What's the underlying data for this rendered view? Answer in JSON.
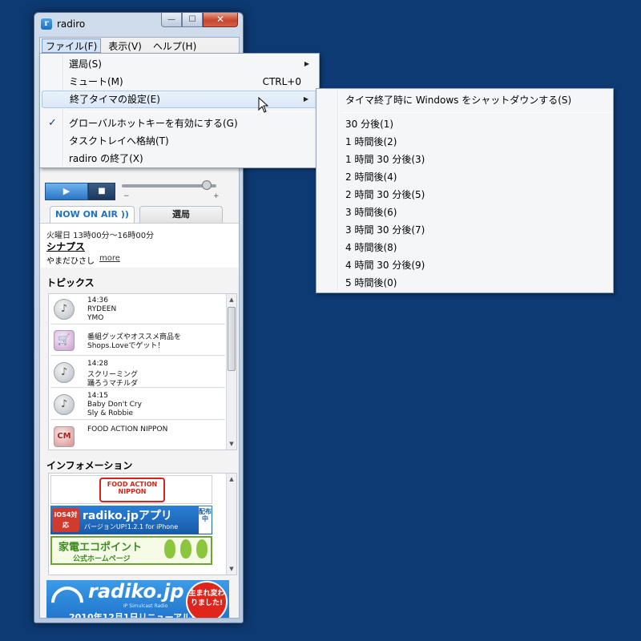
{
  "window": {
    "title": "radiro",
    "min_glyph": "—",
    "max_glyph": "☐",
    "close_glyph": "✕"
  },
  "menubar": {
    "items": [
      "ファイル(F)",
      "表示(V)",
      "ヘルプ(H)"
    ]
  },
  "player": {
    "play_glyph": "▶",
    "stop_glyph": "■",
    "vol_min": "−",
    "vol_max": "+"
  },
  "tabs": {
    "onair": "NOW ON AIR",
    "onair_icon": "))",
    "senkyoku": "選局"
  },
  "program": {
    "time": "火曜日 13時00分～16時00分",
    "title": "シナプス",
    "person": "やまだひさし",
    "more": "more"
  },
  "topics": {
    "heading": "トピックス",
    "items": [
      {
        "icon": "music-note-icon",
        "l1": "14:36",
        "l2": "RYDEEN",
        "l3": "YMO"
      },
      {
        "icon": "cart-icon",
        "l1": "番組グッズやオススメ商品を",
        "l2": "Shops.Loveでゲット！",
        "l3": ""
      },
      {
        "icon": "music-note-icon",
        "l1": "14:28",
        "l2": "スクリーミング",
        "l3": "踊ろうマチルダ"
      },
      {
        "icon": "music-note-icon",
        "l1": "14:15",
        "l2": "Baby Don't Cry",
        "l3": "Sly & Robbie"
      },
      {
        "icon": "cm-logo-icon",
        "l1": "FOOD  ACTION NIPPON",
        "l2": "",
        "l3": ""
      }
    ]
  },
  "info": {
    "heading": "インフォメーション",
    "food_banner": "FOOD ACTION NIPPON",
    "app_banner": {
      "ios": "iOS4対応",
      "name": "radiko.jpアプリ",
      "sub": "バージョンUP!1.2.1 for iPhone",
      "right": "配布中"
    },
    "eco_banner": {
      "title": "家電エコポイント",
      "sub": "公式ホームページ"
    }
  },
  "radiko_banner": {
    "name": "radiko.jp",
    "small": "IP Simulcast Radio",
    "date": "2010年12月1日リニューアル!",
    "circle": "生まれ変わりました!"
  },
  "file_menu": {
    "items": [
      {
        "label": "選局(S)",
        "shortcut": "",
        "submenu": true,
        "checked": false
      },
      {
        "label": "ミュート(M)",
        "shortcut": "CTRL+0",
        "submenu": false,
        "checked": false
      },
      {
        "label": "終了タイマの設定(E)",
        "shortcut": "",
        "submenu": true,
        "checked": false,
        "highlighted": true
      },
      {
        "label": "グローバルホットキーを有効にする(G)",
        "shortcut": "",
        "submenu": false,
        "checked": true
      },
      {
        "label": "タスクトレイへ格納(T)",
        "shortcut": "",
        "submenu": false,
        "checked": false
      },
      {
        "label": "radiro の終了(X)",
        "shortcut": "",
        "submenu": false,
        "checked": false
      }
    ],
    "check_glyph": "✓",
    "arrow_glyph": "▶"
  },
  "timer_menu": {
    "items": [
      "タイマ終了時に Windows をシャットダウンする(S)",
      "30 分後(1)",
      "1 時間後(2)",
      "1 時間 30 分後(3)",
      "2 時間後(4)",
      "2 時間 30 分後(5)",
      "3 時間後(6)",
      "3 時間 30 分後(7)",
      "4 時間後(8)",
      "4 時間 30 分後(9)",
      "5 時間後(0)"
    ]
  },
  "colors": {
    "desktop": "#0d3a73",
    "accent": "#1f6fc8",
    "menu_highlight": "#dbe8f7"
  }
}
